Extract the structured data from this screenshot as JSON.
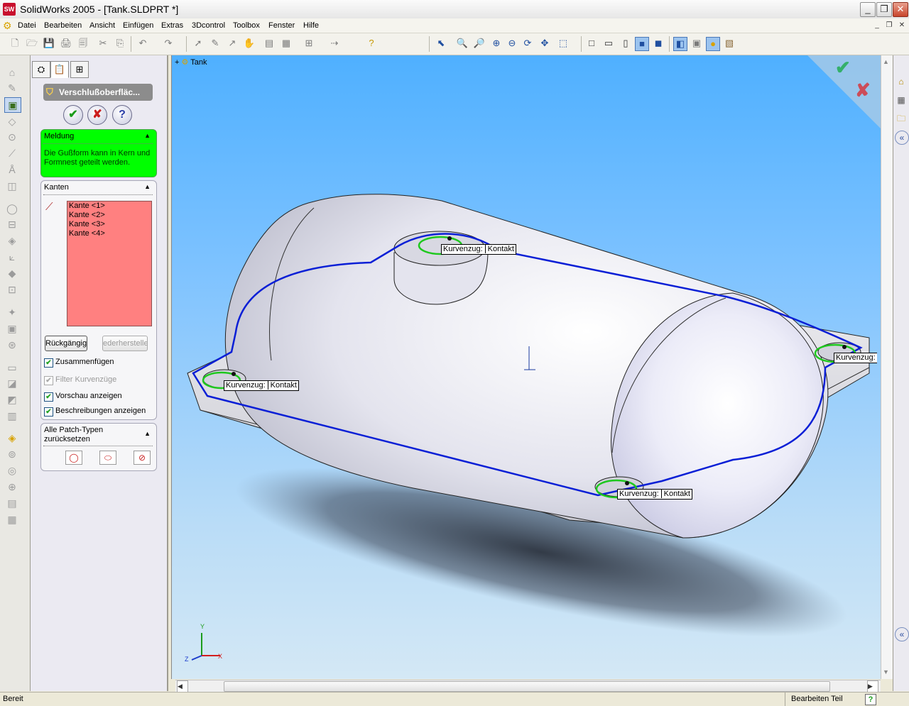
{
  "window": {
    "app_icon": "solidworks-logo-icon",
    "app_icon_text": "SW",
    "title": "SolidWorks 2005 - [Tank.SLDPRT *]",
    "controls": {
      "minimize": "_",
      "restore": "❐",
      "close": "✕"
    }
  },
  "menu": {
    "logo_icon": "solidworks-menu-logo-icon",
    "items": [
      "Datei",
      "Bearbeiten",
      "Ansicht",
      "Einfügen",
      "Extras",
      "3Dcontrol",
      "Toolbox",
      "Fenster",
      "Hilfe"
    ],
    "mdi": {
      "minimize": "_",
      "restore": "❐",
      "close": "✕"
    }
  },
  "toolbar": {
    "standard_glyphs": [
      "🗋",
      "🗁",
      "💾",
      "🖨",
      "🗐",
      "✂",
      "⎘",
      "↶",
      "↷",
      "➚",
      "✎",
      "↗",
      "✋",
      "▤",
      "▦",
      "⊞",
      "⇢",
      "?"
    ],
    "view_glyphs": [
      "⬉",
      "🔍",
      "🔎",
      "⊕",
      "⊖",
      "⟳",
      "✥",
      "⬚",
      "□",
      "▭",
      "▯",
      "■",
      "◼",
      "◧",
      "▣",
      "●",
      "▧"
    ]
  },
  "left_strip": {
    "icons": [
      "⌂",
      "✎",
      "▣",
      "◇",
      "⊙",
      "⟋",
      "Å",
      "◫",
      "◯",
      "⊟",
      "◈",
      "⟀",
      "◆",
      "⊡",
      "✦",
      "▣",
      "⊛",
      "▭",
      "◪",
      "◩",
      "▥",
      "◈",
      "⊚",
      "◎",
      "⊕",
      "▤",
      "▦"
    ]
  },
  "property_manager": {
    "tabs": [
      "feature-manager-tab-icon",
      "property-manager-tab-icon",
      "configuration-manager-tab-icon"
    ],
    "feature_title": "Verschlußoberfläc...",
    "feature_icon": "shut-off-surface-icon",
    "ok_glyph": "✔",
    "cancel_glyph": "✘",
    "help_glyph": "?",
    "message_group": {
      "title": "Meldung",
      "text": "Die Gußform kann in Kern und Formnest geteilt werden."
    },
    "edges_group": {
      "title": "Kanten",
      "items": [
        "Kante <1>",
        "Kante <2>",
        "Kante <3>",
        "Kante <4>"
      ],
      "undo_label": "Rückgängig",
      "redo_label": "ederherstelle",
      "checkboxes": [
        {
          "label": "Zusammenfügen",
          "checked": true,
          "enabled": true
        },
        {
          "label": "Filter Kurvenzüge",
          "checked": true,
          "enabled": false
        },
        {
          "label": "Vorschau anzeigen",
          "checked": true,
          "enabled": true
        },
        {
          "label": "Beschreibungen anzeigen",
          "checked": true,
          "enabled": true
        }
      ]
    },
    "patch_group": {
      "title_line1": "Alle Patch-Typen",
      "title_line2": "zurücksetzen"
    },
    "colors": {
      "message_bg": "#00ff00",
      "edge_list_bg": "#ff8080"
    }
  },
  "viewport": {
    "tree_root": "Tank",
    "callout_key": "Kurvenzug",
    "callout_value": "Kontakt",
    "callouts": [
      {
        "key": "Kurvenzug:",
        "value": "Kontakt"
      },
      {
        "key": "Kurvenzug:",
        "value": "Kontakt"
      },
      {
        "key": "Kurvenzug:",
        "value": "Kontakt"
      },
      {
        "key": "Kurvenzug:",
        "value": ""
      }
    ],
    "triad": {
      "x": "X",
      "y": "Y",
      "z": "Z"
    },
    "confirm_glyph": "✔",
    "cancel_glyph": "✘",
    "colors": {
      "parting_line": "#0a1fd6",
      "contact_loop": "#1ec81e"
    }
  },
  "right_strip": {
    "icons": [
      "⌂",
      "▦",
      "🗀",
      "«",
      "«"
    ]
  },
  "status": {
    "left": "Bereit",
    "right": "Bearbeiten Teil",
    "help_glyph": "?"
  }
}
